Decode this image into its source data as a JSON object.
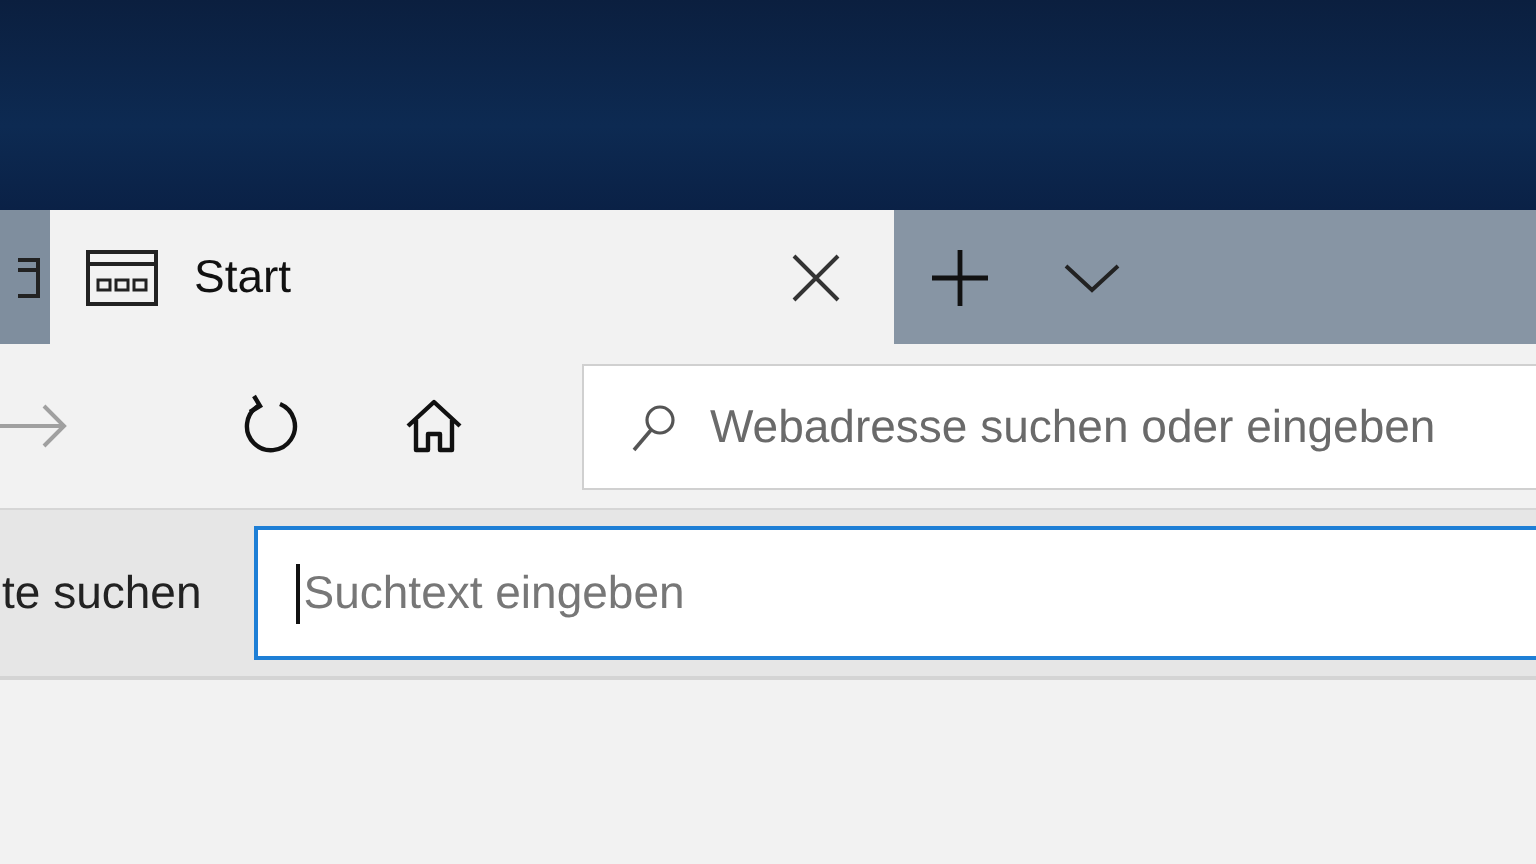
{
  "tabs": [
    {
      "kind": "partial",
      "selected": false
    },
    {
      "kind": "full",
      "label": "Start",
      "selected": true
    }
  ],
  "tab_actions": [
    {
      "kind": "new-tab"
    },
    {
      "kind": "tab-list"
    }
  ],
  "nav_buttons": [
    {
      "kind": "forward",
      "disabled": true
    },
    {
      "kind": "refresh",
      "disabled": false
    },
    {
      "kind": "home",
      "disabled": false
    }
  ],
  "address_bar": {
    "placeholder": "Webadresse suchen oder eingeben"
  },
  "find_bar": {
    "label": "te suchen",
    "search_field": {
      "placeholder": "Suchtext eingeben",
      "focused": true
    }
  }
}
